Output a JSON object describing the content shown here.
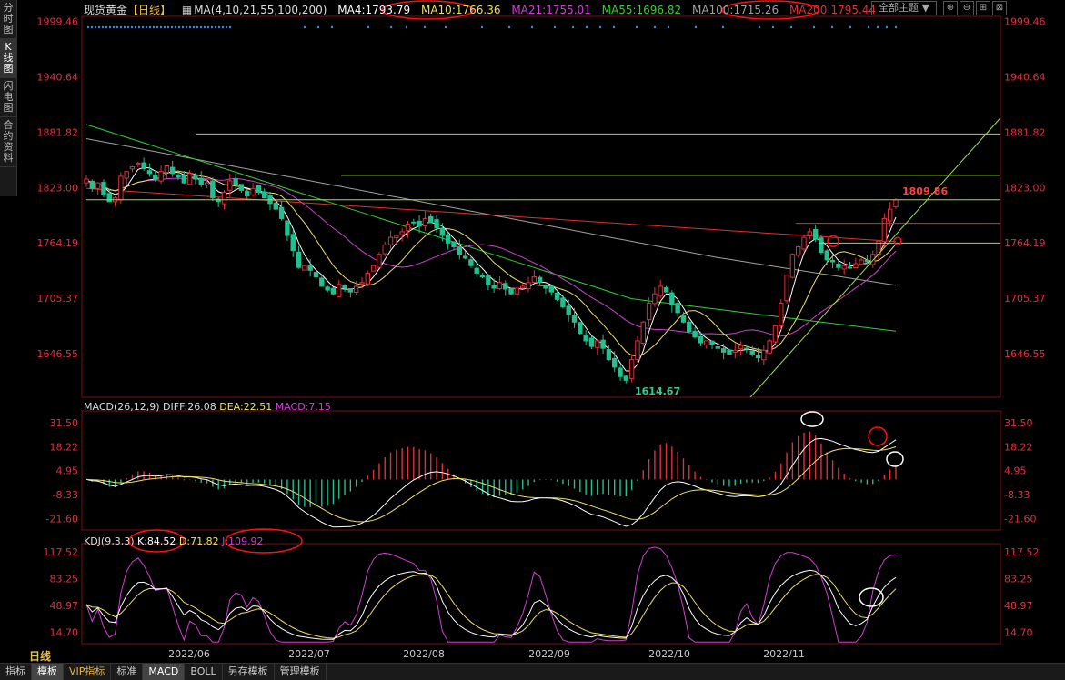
{
  "left_tabs": [
    "分时图",
    "K线图",
    "闪电图",
    "合约资料"
  ],
  "header": {
    "title": "现货黄金",
    "period": "【日线】",
    "ma_label": "MA(4,10,21,55,100,200)",
    "ma4": "MA4:1793.79",
    "ma10": "MA10:1766.36",
    "ma21": "MA21:1755.01",
    "ma55": "MA55:1696.82",
    "ma100": "MA100:1715.26",
    "ma200": "MA200:1795.44",
    "theme": "全部主题 ▼",
    "buttons": [
      "⊕",
      "⊖",
      "⊞",
      "⊠"
    ]
  },
  "macd": {
    "label": "MACD(26,12,9)",
    "diff": "DIFF:26.08",
    "dea": "DEA:22.51",
    "macd": "MACD:7.15"
  },
  "kdj": {
    "label": "KDJ(9,3,3)",
    "k": "K:84.52",
    "d": "D:71.82",
    "j": "J:109.92"
  },
  "period_label": "日线",
  "bottom_tabs": [
    "指标",
    "模板",
    "VIP指标",
    "标准",
    "MACD",
    "BOLL",
    "另存模板",
    "管理模板"
  ],
  "chart_data": [
    {
      "type": "candlestick",
      "title": "现货黄金 日线",
      "y_ticks": [
        "1999.46",
        "1940.64",
        "1881.82",
        "1823.00",
        "1764.19",
        "1705.37",
        "1646.55"
      ],
      "ylim": [
        1600,
        2005
      ],
      "x_ticks": [
        "2022/06",
        "2022/07",
        "2022/08",
        "2022/09",
        "2022/10",
        "2022/11"
      ],
      "annotations": [
        "1809.86",
        "1614.67"
      ],
      "close_series": [
        1832,
        1822,
        1828,
        1815,
        1808,
        1812,
        1835,
        1840,
        1845,
        1849,
        1843,
        1838,
        1832,
        1840,
        1846,
        1838,
        1834,
        1828,
        1838,
        1832,
        1826,
        1828,
        1812,
        1808,
        1818,
        1830,
        1826,
        1820,
        1814,
        1822,
        1818,
        1812,
        1806,
        1800,
        1790,
        1772,
        1756,
        1738,
        1740,
        1735,
        1728,
        1718,
        1714,
        1710,
        1720,
        1716,
        1712,
        1718,
        1722,
        1732,
        1740,
        1752,
        1762,
        1770,
        1772,
        1776,
        1784,
        1786,
        1782,
        1790,
        1786,
        1780,
        1772,
        1764,
        1760,
        1752,
        1748,
        1740,
        1732,
        1728,
        1720,
        1716,
        1722,
        1715,
        1710,
        1716,
        1718,
        1722,
        1728,
        1722,
        1716,
        1712,
        1704,
        1696,
        1688,
        1680,
        1668,
        1660,
        1654,
        1660,
        1652,
        1640,
        1632,
        1622,
        1618,
        1640,
        1660,
        1680,
        1700,
        1710,
        1718,
        1712,
        1698,
        1690,
        1680,
        1670,
        1664,
        1658,
        1660,
        1656,
        1652,
        1648,
        1646,
        1650,
        1655,
        1652,
        1646,
        1642,
        1650,
        1660,
        1676,
        1700,
        1730,
        1752,
        1760,
        1770,
        1776,
        1768,
        1754,
        1746,
        1744,
        1738,
        1740,
        1738,
        1742,
        1746,
        1744,
        1752,
        1766,
        1790,
        1800,
        1809.86
      ]
    },
    {
      "type": "bar",
      "title": "MACD(26,12,9)",
      "y_ticks": [
        "31.50",
        "18.22",
        "4.95",
        "-8.33",
        "-21.60"
      ],
      "ylim": [
        -28,
        38
      ],
      "series": [
        {
          "name": "DIFF",
          "last": 26.08
        },
        {
          "name": "DEA",
          "last": 22.51
        },
        {
          "name": "MACD",
          "last": 7.15
        }
      ]
    },
    {
      "type": "line",
      "title": "KDJ(9,3,3)",
      "y_ticks": [
        "117.52",
        "83.25",
        "48.97",
        "14.70"
      ],
      "ylim": [
        0,
        128
      ],
      "series": [
        {
          "name": "K",
          "last": 84.52
        },
        {
          "name": "D",
          "last": 71.82
        },
        {
          "name": "J",
          "last": 109.92
        }
      ]
    }
  ],
  "colors": {
    "up": "#e0303a",
    "down": "#20c090",
    "ma4": "#ffffff",
    "ma10": "#f0e060",
    "ma21": "#d040d0",
    "ma55": "#30d030",
    "ma100": "#a0a0a0",
    "ma200": "#e03030",
    "trend": "#a0e040",
    "circle_red": "#ff1010",
    "circle_white": "#ffffff",
    "axis": "#e0303a",
    "dots": "#3a8fe0"
  }
}
